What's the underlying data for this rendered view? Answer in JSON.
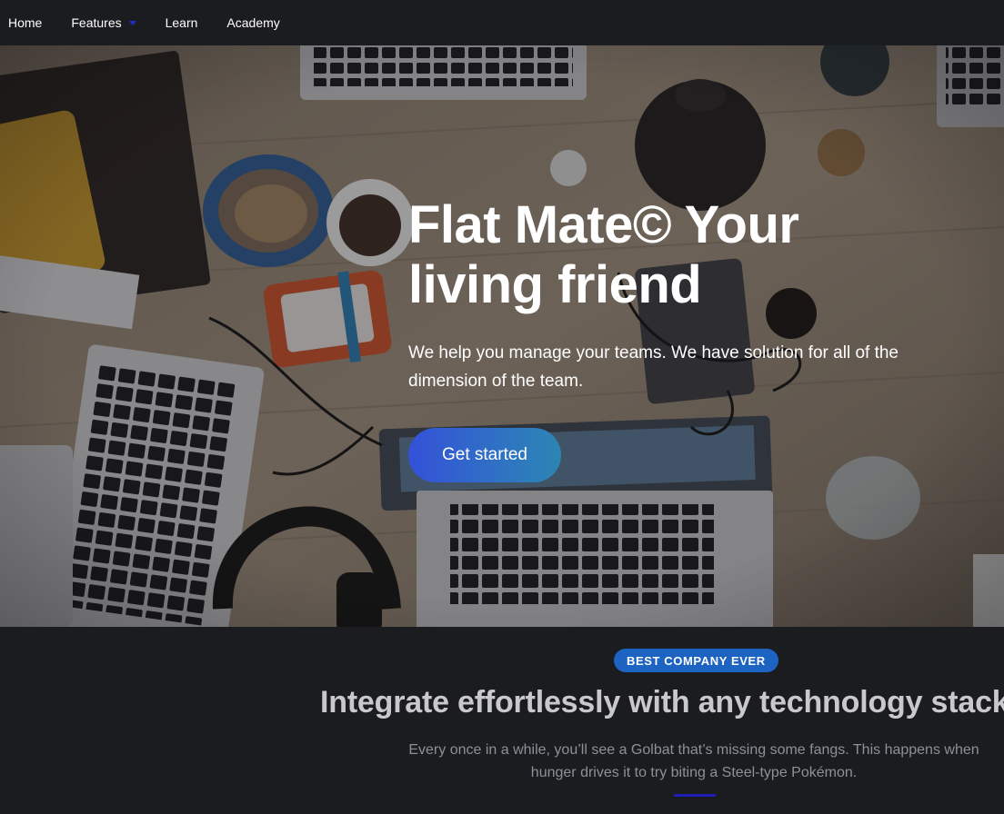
{
  "nav": {
    "items": [
      {
        "label": "Home"
      },
      {
        "label": "Features",
        "has_dropdown": true
      },
      {
        "label": "Learn"
      },
      {
        "label": "Academy"
      }
    ],
    "caret_color": "#1f2cc9"
  },
  "hero": {
    "title": "Flat Mate© Your living friend",
    "subtitle": "We help you manage your teams. We have solution for all of the dimension of the team.",
    "cta_label": "Get started",
    "cta_gradient": [
      "#3351d8",
      "#2b86b2"
    ]
  },
  "section": {
    "badge": "BEST COMPANY EVER",
    "title": "Integrate effortlessly with any technology stack",
    "text": "Every once in a while, you’ll see a Golbat that’s missing some fangs. This happens when hunger drives it to try biting a Steel-type Pokémon.",
    "accent_color": "#1f1fb8"
  }
}
